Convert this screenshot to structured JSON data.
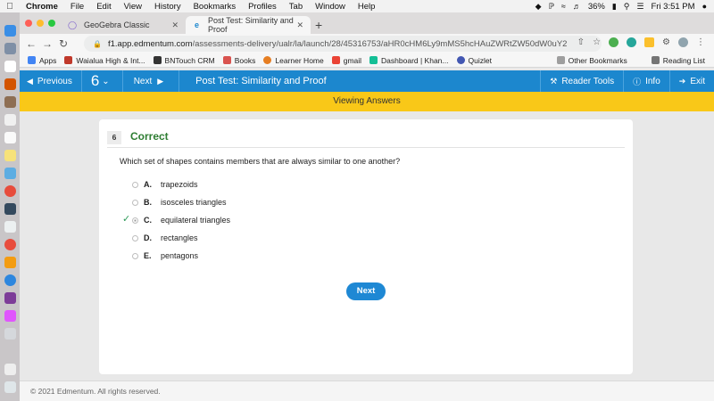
{
  "os_menu": {
    "app": "Chrome",
    "items": [
      "File",
      "Edit",
      "View",
      "History",
      "Bookmarks",
      "Profiles",
      "Tab",
      "Window",
      "Help"
    ],
    "battery": "36%",
    "clock": "Fri 3:51 PM"
  },
  "browser": {
    "tabs": [
      {
        "title": "GeoGebra Classic",
        "icon": "geogebra-icon"
      },
      {
        "title": "Post Test: Similarity and Proof",
        "icon": "edmentum-icon"
      }
    ],
    "url_host": "f1.app.edmentum.com",
    "url_path": "/assessments-delivery/ualr/la/launch/28/45316753/aHR0cHM6Ly9mMS5hcHAuZWRtZW50dW0uY29tL2xlYXJ...",
    "bookmarks": [
      {
        "label": "Apps",
        "color": "#4285f4"
      },
      {
        "label": "Waialua High & Int...",
        "color": "#c0392b"
      },
      {
        "label": "BNTouch CRM",
        "color": "#333333"
      },
      {
        "label": "Books",
        "color": "#d9534f"
      },
      {
        "label": "Learner Home",
        "color": "#e67e22"
      },
      {
        "label": "gmail",
        "color": "#ea4335"
      },
      {
        "label": "Dashboard | Khan...",
        "color": "#14bf96"
      },
      {
        "label": "Quizlet",
        "color": "#4257b2"
      }
    ],
    "bookmarks_right": [
      "Other Bookmarks",
      "Reading List"
    ]
  },
  "app": {
    "previous": "Previous",
    "question_number": "6",
    "next": "Next",
    "title": "Post Test: Similarity and Proof",
    "reader_tools": "Reader Tools",
    "info": "Info",
    "exit": "Exit",
    "mode": "Viewing Answers"
  },
  "question": {
    "number": "6",
    "status": "Correct",
    "text": "Which set of shapes contains members that are always similar to one another?",
    "options": [
      {
        "letter": "A.",
        "text": "trapezoids",
        "selected": false,
        "correct": false
      },
      {
        "letter": "B.",
        "text": "isosceles triangles",
        "selected": false,
        "correct": false
      },
      {
        "letter": "C.",
        "text": "equilateral triangles",
        "selected": true,
        "correct": true
      },
      {
        "letter": "D.",
        "text": "rectangles",
        "selected": false,
        "correct": false
      },
      {
        "letter": "E.",
        "text": "pentagons",
        "selected": false,
        "correct": false
      }
    ],
    "next_button": "Next"
  },
  "footer": "© 2021 Edmentum. All rights reserved.",
  "colors": {
    "brand_blue": "#1c87ce",
    "banner_yellow": "#f9c818",
    "correct_green": "#2e7d32"
  }
}
